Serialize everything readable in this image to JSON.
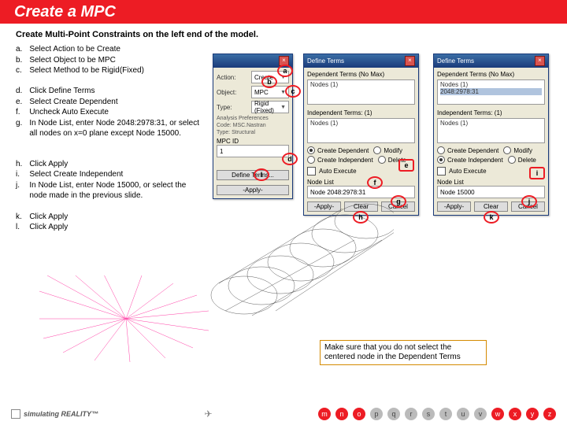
{
  "page": {
    "title": "Create a MPC",
    "subtitle": "Create Multi-Point Constraints on the left end of the model."
  },
  "steps": {
    "a": {
      "letter": "a.",
      "text": "Select Action to be Create"
    },
    "b": {
      "letter": "b.",
      "text": "Select Object to be MPC"
    },
    "c": {
      "letter": "c.",
      "text": "Select Method to be Rigid(Fixed)"
    },
    "d": {
      "letter": "d.",
      "text": "Click Define Terms"
    },
    "e": {
      "letter": "e.",
      "text": "Select Create Dependent"
    },
    "f": {
      "letter": "f.",
      "text": "Uncheck Auto Execute"
    },
    "g": {
      "letter": "g.",
      "text": "In Node List, enter Node 2048:2978:31, or select all nodes on x=0 plane except Node 15000."
    },
    "h": {
      "letter": "h.",
      "text": "Click Apply"
    },
    "i": {
      "letter": "i.",
      "text": "Select Create Independent"
    },
    "j": {
      "letter": "j.",
      "text": "In Node List, enter Node 15000, or select the node made in the previous slide."
    },
    "k": {
      "letter": "k.",
      "text": "Click Apply"
    },
    "l": {
      "letter": "l.",
      "text": "Click Apply"
    }
  },
  "mainDialog": {
    "title": "",
    "action": {
      "label": "Action:",
      "value": "Create"
    },
    "object": {
      "label": "Object:",
      "value": "MPC"
    },
    "type": {
      "label": "Type:",
      "value": "Rigid (Fixed)"
    },
    "analysis": "Analysis Preferences",
    "code": "Code: MSC.Nastran",
    "typedef": "Type: Structural",
    "mpcid": {
      "label": "MPC ID",
      "value": "1"
    },
    "defineTerms": "Define Terms...",
    "apply": "-Apply-"
  },
  "termsDialogDep": {
    "title": "Define Terms",
    "depHeader": "Dependent Terms (No Max)",
    "col1": "Nodes (1)",
    "indepHeader": "Independent Terms: (1)",
    "createDep": "Create Dependent",
    "createIndep": "Create Independent",
    "modify": "Modify",
    "delete": "Delete",
    "autoExec": "Auto Execute",
    "nodeListLabel": "Node List",
    "nodeListValue": "Node 2048:2978:31",
    "apply": "-Apply-",
    "clear": "Clear",
    "cancel": "Cancel"
  },
  "termsDialogIndep": {
    "title": "Define Terms",
    "depHeader": "Dependent Terms (No Max)",
    "col1": "Nodes (1)",
    "depRow": "2048:2978:31",
    "indepHeader": "Independent Terms: (1)",
    "createDep": "Create Dependent",
    "createIndep": "Create Independent",
    "modify": "Modify",
    "delete": "Delete",
    "autoExec": "Auto Execute",
    "nodeListLabel": "Node List",
    "nodeListValue": "Node 15000",
    "apply": "-Apply-",
    "clear": "Clear",
    "cancel": "Cancel"
  },
  "markers": {
    "a": "a",
    "b": "b",
    "c": "c",
    "d": "d",
    "e": "e",
    "f": "f",
    "g": "g",
    "h": "h",
    "i": "i",
    "j": "j",
    "k": "k",
    "l": "l"
  },
  "note": "Make sure that you do not select the centered node in the Dependent Terms",
  "footer": {
    "brand": "simulating REALITY™",
    "nav": [
      "m",
      "n",
      "o",
      "p",
      "q",
      "r",
      "s",
      "t",
      "u",
      "v",
      "w",
      "x",
      "y",
      "z"
    ]
  }
}
